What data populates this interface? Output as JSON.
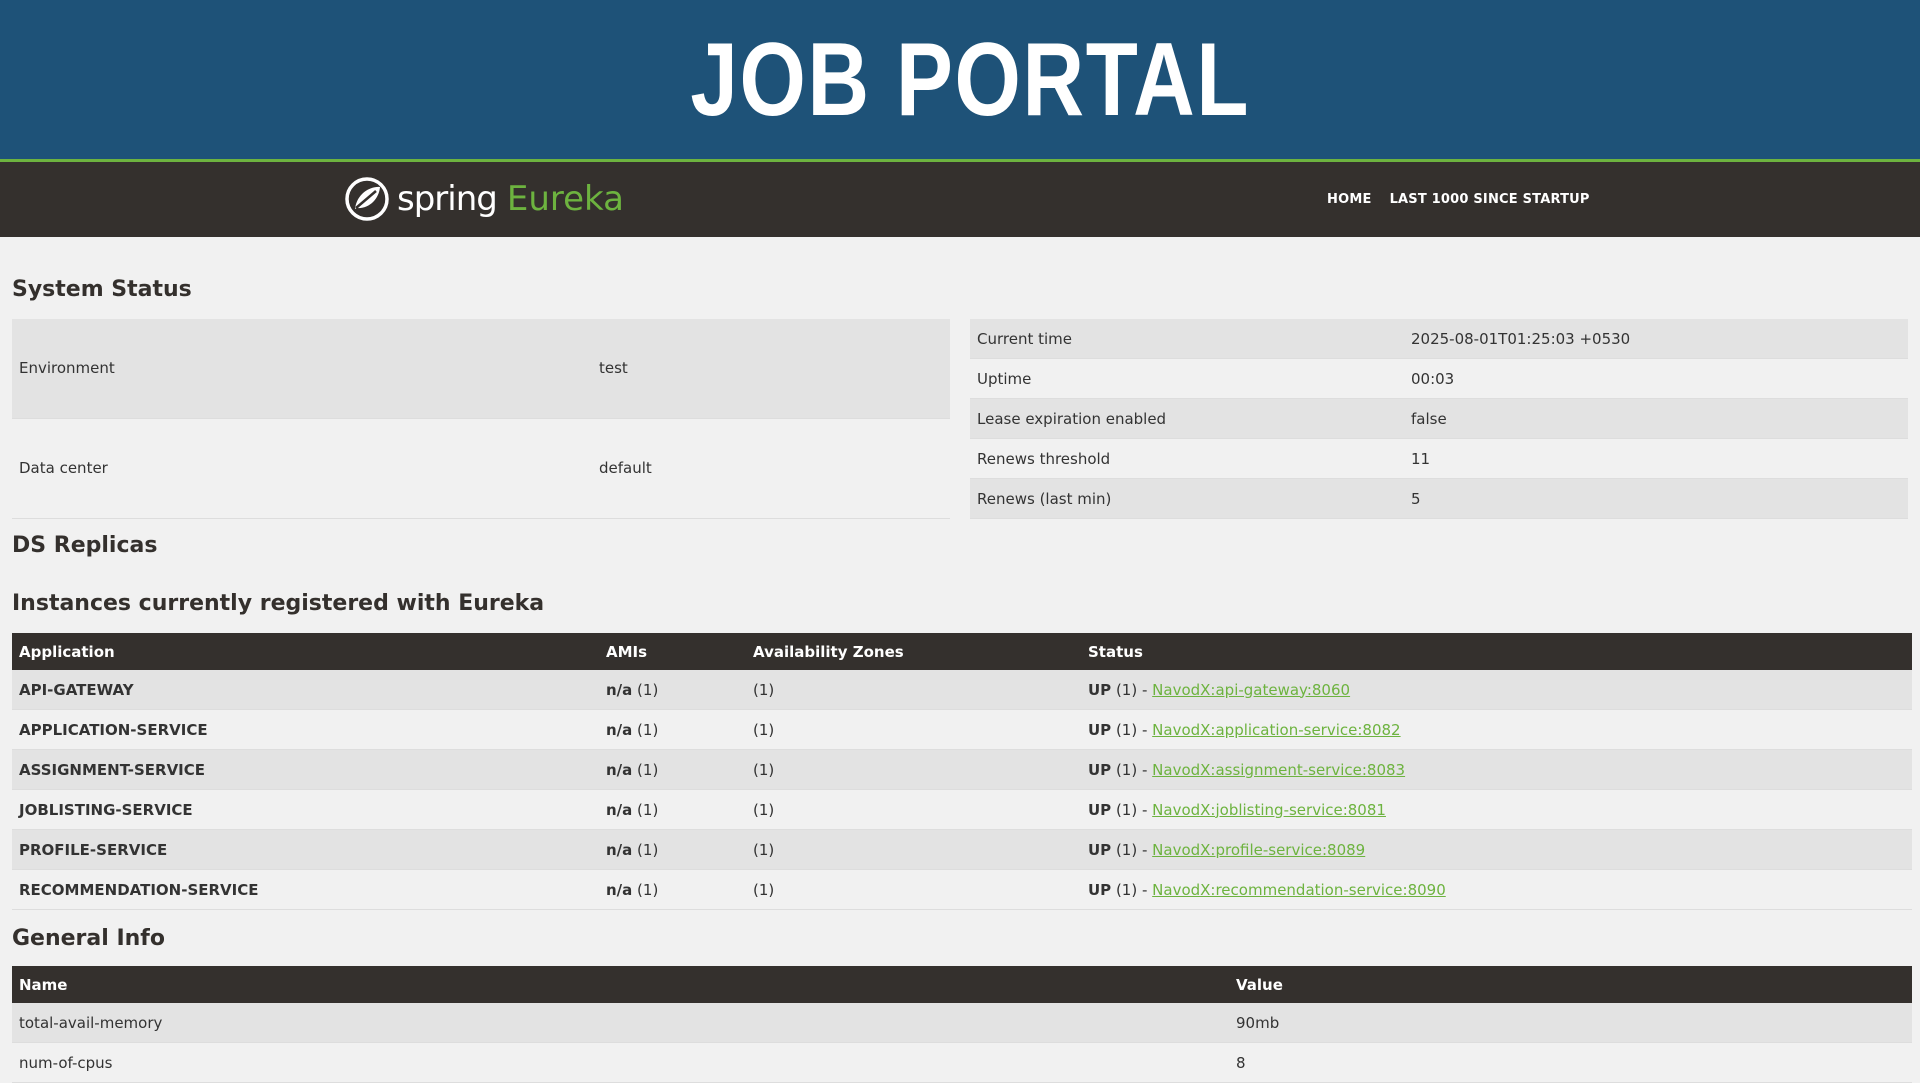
{
  "banner": {
    "title": "JOB PORTAL"
  },
  "navbar": {
    "brand_spring": "spring",
    "brand_eureka": "Eureka",
    "links": [
      {
        "label": "HOME"
      },
      {
        "label": "LAST 1000 SINCE STARTUP"
      }
    ]
  },
  "system_status": {
    "heading": "System Status",
    "left": [
      {
        "key": "Environment",
        "value": "test"
      },
      {
        "key": "Data center",
        "value": "default"
      }
    ],
    "right": [
      {
        "key": "Current time",
        "value": "2025-08-01T01:25:03 +0530"
      },
      {
        "key": "Uptime",
        "value": "00:03"
      },
      {
        "key": "Lease expiration enabled",
        "value": "false"
      },
      {
        "key": "Renews threshold",
        "value": "11"
      },
      {
        "key": "Renews (last min)",
        "value": "5"
      }
    ]
  },
  "ds_replicas": {
    "heading": "DS Replicas"
  },
  "instances": {
    "heading": "Instances currently registered with Eureka",
    "columns": [
      "Application",
      "AMIs",
      "Availability Zones",
      "Status"
    ],
    "rows": [
      {
        "app": "API-GATEWAY",
        "ami_name": "n/a",
        "ami_count": " (1)",
        "zones": "(1)",
        "status": "UP",
        "status_count": " (1) - ",
        "link": "NavodX:api-gateway:8060"
      },
      {
        "app": "APPLICATION-SERVICE",
        "ami_name": "n/a",
        "ami_count": " (1)",
        "zones": "(1)",
        "status": "UP",
        "status_count": " (1) - ",
        "link": "NavodX:application-service:8082"
      },
      {
        "app": "ASSIGNMENT-SERVICE",
        "ami_name": "n/a",
        "ami_count": " (1)",
        "zones": "(1)",
        "status": "UP",
        "status_count": " (1) - ",
        "link": "NavodX:assignment-service:8083"
      },
      {
        "app": "JOBLISTING-SERVICE",
        "ami_name": "n/a",
        "ami_count": " (1)",
        "zones": "(1)",
        "status": "UP",
        "status_count": " (1) - ",
        "link": "NavodX:joblisting-service:8081"
      },
      {
        "app": "PROFILE-SERVICE",
        "ami_name": "n/a",
        "ami_count": " (1)",
        "zones": "(1)",
        "status": "UP",
        "status_count": " (1) - ",
        "link": "NavodX:profile-service:8089"
      },
      {
        "app": "RECOMMENDATION-SERVICE",
        "ami_name": "n/a",
        "ami_count": " (1)",
        "zones": "(1)",
        "status": "UP",
        "status_count": " (1) - ",
        "link": "NavodX:recommendation-service:8090"
      }
    ]
  },
  "general_info": {
    "heading": "General Info",
    "columns": [
      "Name",
      "Value"
    ],
    "rows": [
      {
        "name": "total-avail-memory",
        "value": "90mb"
      },
      {
        "name": "num-of-cpus",
        "value": "8"
      }
    ]
  },
  "colors": {
    "banner": "#1e5278",
    "navbar": "#34302d",
    "accent": "#6db33f",
    "background": "#f1f1f1"
  },
  "icons": {
    "brand": "spring-leaf-icon"
  }
}
